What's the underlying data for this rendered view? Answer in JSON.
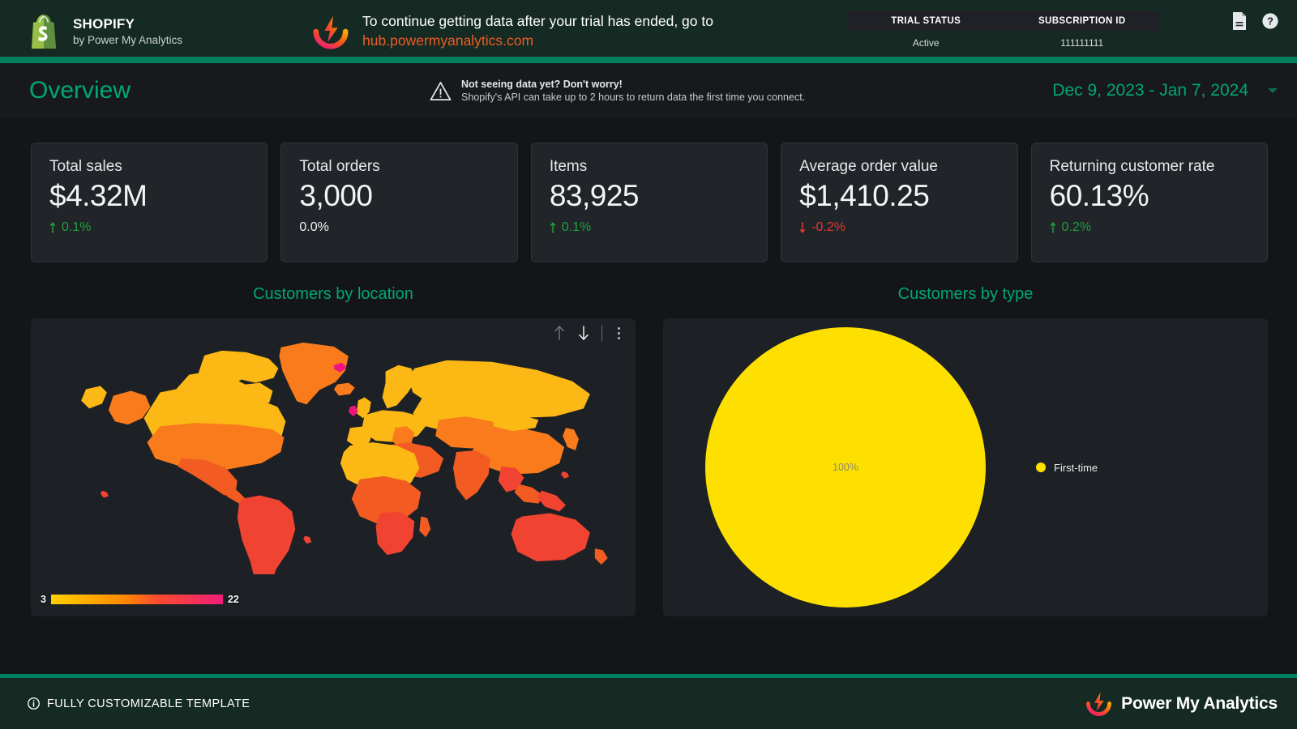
{
  "topbar": {
    "logo_icon": "shopify-bag-icon",
    "brand_title": "SHOPIFY",
    "brand_subtitle": "by Power My Analytics",
    "promo_icon": "power-my-analytics-logo-icon",
    "promo_text": "To continue getting data after your trial has ended, go to",
    "promo_link": "hub.powermyanalytics.com",
    "status": {
      "trial_status_header": "TRIAL STATUS",
      "subscription_id_header": "SUBSCRIPTION ID",
      "trial_status_value": "Active",
      "subscription_id_value": "111111111"
    },
    "doc_icon": "document-icon",
    "help_icon": "help-circle-icon",
    "divider_color": "#00805f"
  },
  "subheader": {
    "page_title": "Overview",
    "warning_icon": "warning-triangle-icon",
    "notice_title": "Not seeing data yet? Don't worry!",
    "notice_body": "Shopify's API can take up to 2 hours to return data the first time you connect.",
    "date_range": "Dec 9, 2023 - Jan 7, 2024",
    "caret_icon": "chevron-down-icon",
    "accent_color": "#00a870"
  },
  "kpis": [
    {
      "label": "Total sales",
      "value": "$4.32M",
      "delta": "0.1%",
      "direction": "up",
      "color": "#21a03c"
    },
    {
      "label": "Total orders",
      "value": "3,000",
      "delta": "0.0%",
      "direction": "flat",
      "color": "#f2f4f6"
    },
    {
      "label": "Items",
      "value": "83,925",
      "delta": "0.1%",
      "direction": "up",
      "color": "#21a03c"
    },
    {
      "label": "Average order value",
      "value": "$1,410.25",
      "delta": "-0.2%",
      "direction": "down",
      "color": "#e03b32"
    },
    {
      "label": "Returning customer rate",
      "value": "60.13%",
      "delta": "0.2%",
      "direction": "up",
      "color": "#21a03c"
    }
  ],
  "panels": {
    "map": {
      "title": "Customers by location",
      "toolbar": {
        "sort_asc_icon": "arrow-up-icon",
        "sort_desc_icon": "arrow-down-icon",
        "more_icon": "kebab-menu-icon"
      },
      "legend_min": "3",
      "legend_max": "22"
    },
    "pie": {
      "title": "Customers by type",
      "center_label": "100%",
      "legend_label": "First-time",
      "legend_color": "#fde000"
    }
  },
  "footer": {
    "info_icon": "info-circle-icon",
    "text": "FULLY CUSTOMIZABLE TEMPLATE",
    "logo_icon": "power-my-analytics-logo-icon",
    "logo_text": "Power My Analytics"
  },
  "chart_data": [
    {
      "type": "heatmap",
      "title": "Customers by location",
      "subtitle": "",
      "xlabel": "",
      "ylabel": "",
      "legend_position": "bottom-left",
      "scale_min": 3,
      "scale_max": 22,
      "colorscale": [
        "#ffd000",
        "#ff8a00",
        "#fb4c2f",
        "#f01e7a"
      ],
      "regions": [
        {
          "name": "United States",
          "value": 14
        },
        {
          "name": "Canada",
          "value": 7
        },
        {
          "name": "Greenland",
          "value": 13
        },
        {
          "name": "Mexico",
          "value": 15
        },
        {
          "name": "Brazil",
          "value": 19
        },
        {
          "name": "Argentina",
          "value": 18
        },
        {
          "name": "United Kingdom",
          "value": 21
        },
        {
          "name": "France",
          "value": 9
        },
        {
          "name": "Germany",
          "value": 8
        },
        {
          "name": "Norway",
          "value": 22
        },
        {
          "name": "Russia",
          "value": 6
        },
        {
          "name": "China",
          "value": 12
        },
        {
          "name": "India",
          "value": 16
        },
        {
          "name": "Australia",
          "value": 18
        },
        {
          "name": "South Africa",
          "value": 17
        },
        {
          "name": "Nigeria",
          "value": 11
        },
        {
          "name": "Egypt",
          "value": 10
        }
      ]
    },
    {
      "type": "pie",
      "title": "Customers by type",
      "categories": [
        "First-time"
      ],
      "values": [
        100
      ],
      "value_labels": [
        "100%"
      ],
      "colors": [
        "#fde000"
      ],
      "legend_position": "right"
    }
  ]
}
